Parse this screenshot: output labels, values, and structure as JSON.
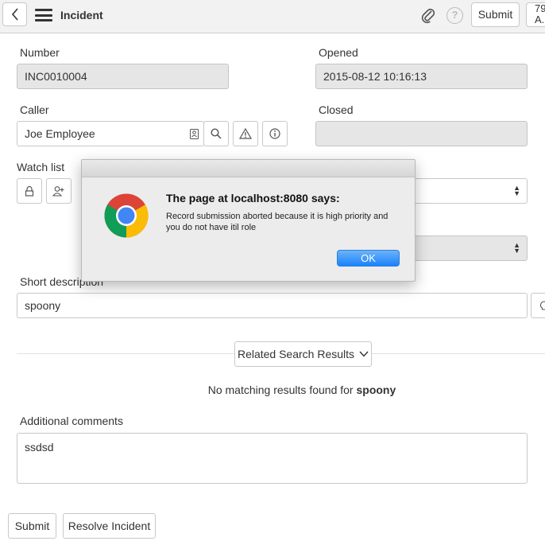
{
  "header": {
    "title": "Incident",
    "submit_label": "Submit",
    "extra_label": "79 A..."
  },
  "form": {
    "number_label": "Number",
    "number_value": "INC0010004",
    "opened_label": "Opened",
    "opened_value": "2015-08-12 10:16:13",
    "caller_label": "Caller",
    "caller_value": "Joe Employee",
    "closed_label": "Closed",
    "closed_value": "",
    "watch_list_label": "Watch list",
    "short_description_label": "Short description",
    "short_description_value": "spoony",
    "related_search_label": "Related Search Results",
    "no_results_prefix": "No matching results found for",
    "no_results_term": "spoony",
    "additional_comments_label": "Additional comments",
    "additional_comments_value": "ssdsd"
  },
  "footer": {
    "submit_label": "Submit",
    "resolve_label": "Resolve Incident"
  },
  "dialog": {
    "title": "The page at localhost:8080 says:",
    "message": "Record submission aborted because it is high priority and you do not have itil role",
    "ok_label": "OK"
  },
  "colors": {
    "ok_button": "#1a82fb",
    "readonly_field": "#e6e6e6",
    "header_bg": "#f2f2f2"
  }
}
